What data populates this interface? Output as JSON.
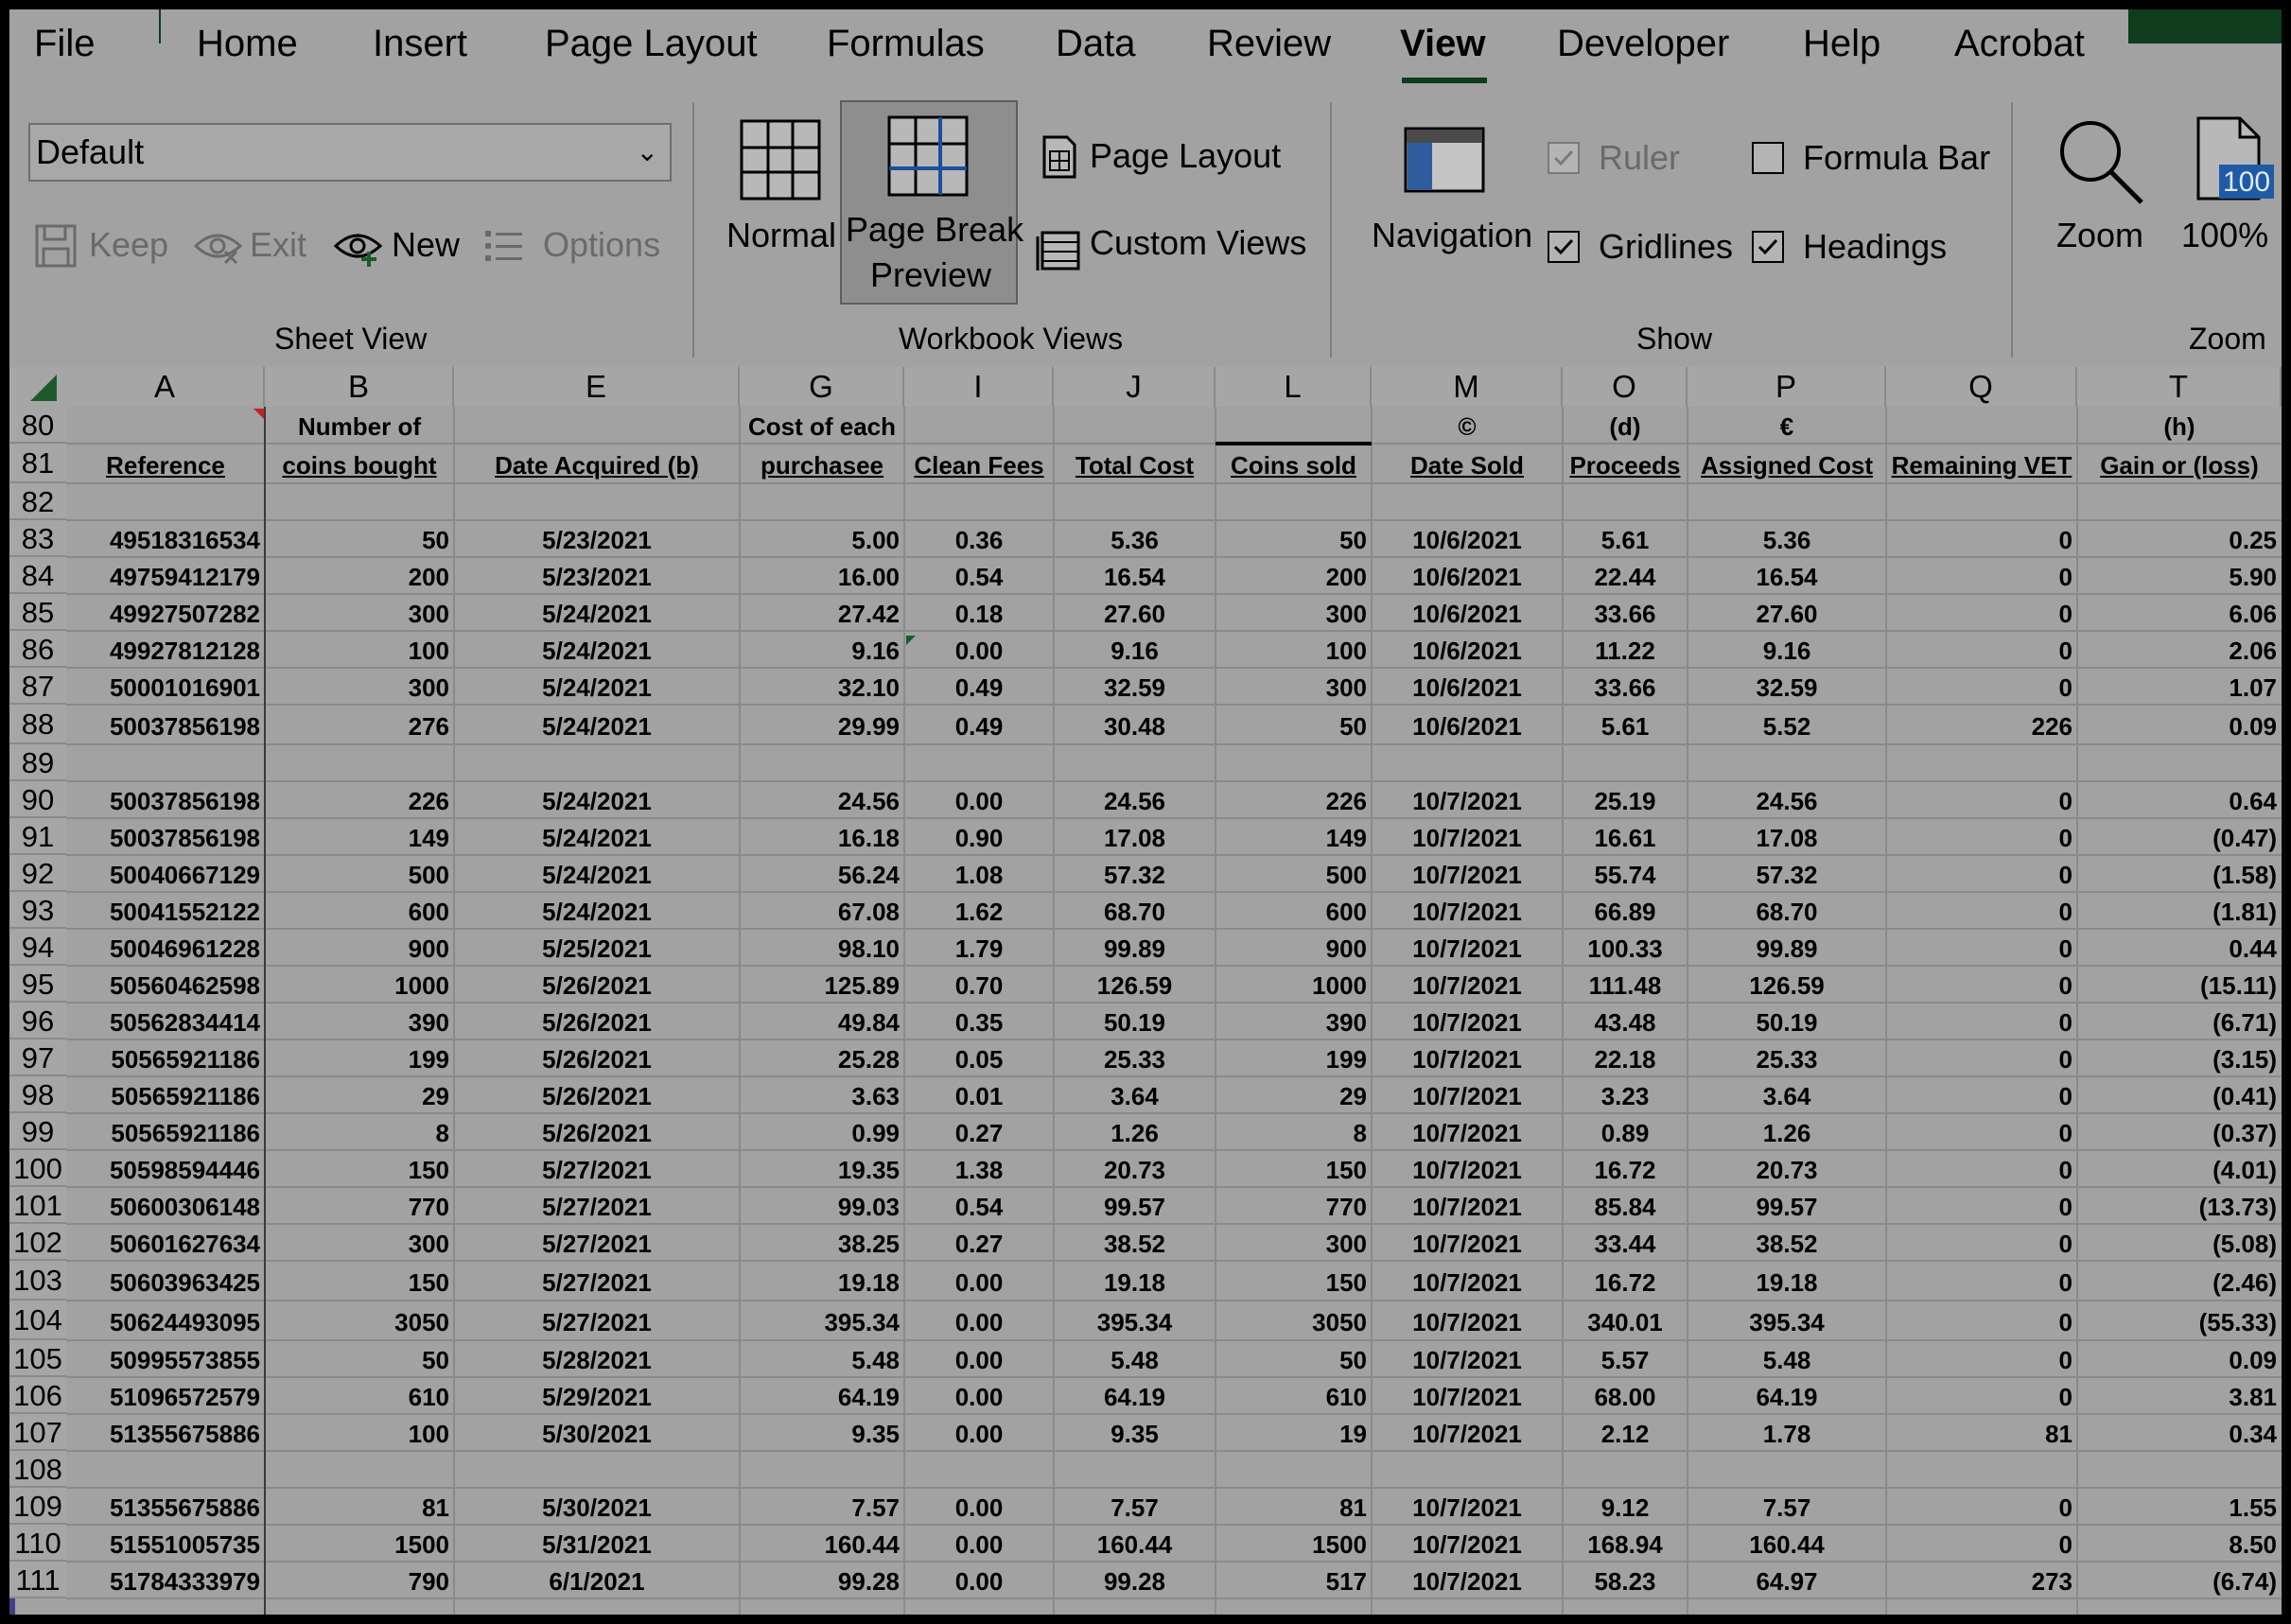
{
  "menu": {
    "tabs": [
      "File",
      "Home",
      "Insert",
      "Page Layout",
      "Formulas",
      "Data",
      "Review",
      "View",
      "Developer",
      "Help",
      "Acrobat"
    ],
    "active": "View"
  },
  "ribbon": {
    "sheet_view": {
      "select_value": "Default",
      "keep": "Keep",
      "exit": "Exit",
      "new": "New",
      "options": "Options",
      "label": "Sheet View"
    },
    "workbook_views": {
      "normal": "Normal",
      "page_break_1": "Page Break",
      "page_break_2": "Preview",
      "page_layout": "Page Layout",
      "custom_views": "Custom Views",
      "label": "Workbook Views"
    },
    "show": {
      "navigation": "Navigation",
      "ruler": "Ruler",
      "formula_bar": "Formula Bar",
      "gridlines": "Gridlines",
      "headings": "Headings",
      "label": "Show"
    },
    "zoom": {
      "zoom": "Zoom",
      "hundred": "100%",
      "icon_text": "100",
      "label": "Zoom"
    }
  },
  "sheet": {
    "columns": [
      "A",
      "B",
      "E",
      "G",
      "I",
      "J",
      "L",
      "M",
      "O",
      "P",
      "Q",
      "T"
    ],
    "header_rows": [
      {
        "row": "80",
        "cells": [
          "",
          "Number of",
          "",
          "Cost of each",
          "",
          "",
          "",
          "©",
          "(d)",
          "€",
          "",
          "(h)"
        ]
      },
      {
        "row": "81",
        "cells": [
          "Reference",
          "coins bought",
          "Date Acquired (b)",
          "purchasee",
          "Clean Fees",
          "Total Cost",
          "Coins sold",
          "Date Sold",
          "Proceeds",
          "Assigned Cost",
          "Remaining VET",
          "Gain or (loss)"
        ]
      }
    ],
    "rows": [
      {
        "row": "82",
        "cells": [
          "",
          "",
          "",
          "",
          "",
          "",
          "",
          "",
          "",
          "",
          "",
          ""
        ]
      },
      {
        "row": "83",
        "cells": [
          "49518316534",
          "50",
          "5/23/2021",
          "5.00",
          "0.36",
          "5.36",
          "50",
          "10/6/2021",
          "5.61",
          "5.36",
          "0",
          "0.25"
        ]
      },
      {
        "row": "84",
        "cells": [
          "49759412179",
          "200",
          "5/23/2021",
          "16.00",
          "0.54",
          "16.54",
          "200",
          "10/6/2021",
          "22.44",
          "16.54",
          "0",
          "5.90"
        ]
      },
      {
        "row": "85",
        "cells": [
          "49927507282",
          "300",
          "5/24/2021",
          "27.42",
          "0.18",
          "27.60",
          "300",
          "10/6/2021",
          "33.66",
          "27.60",
          "0",
          "6.06"
        ]
      },
      {
        "row": "86",
        "cells": [
          "49927812128",
          "100",
          "5/24/2021",
          "9.16",
          "0.00",
          "9.16",
          "100",
          "10/6/2021",
          "11.22",
          "9.16",
          "0",
          "2.06"
        ]
      },
      {
        "row": "87",
        "cells": [
          "50001016901",
          "300",
          "5/24/2021",
          "32.10",
          "0.49",
          "32.59",
          "300",
          "10/6/2021",
          "33.66",
          "32.59",
          "0",
          "1.07"
        ]
      },
      {
        "row": "88",
        "cells": [
          "50037856198",
          "276",
          "5/24/2021",
          "29.99",
          "0.49",
          "30.48",
          "50",
          "10/6/2021",
          "5.61",
          "5.52",
          "226",
          "0.09"
        ]
      },
      {
        "row": "89",
        "cells": [
          "",
          "",
          "",
          "",
          "",
          "",
          "",
          "",
          "",
          "",
          "",
          ""
        ]
      },
      {
        "row": "90",
        "cells": [
          "50037856198",
          "226",
          "5/24/2021",
          "24.56",
          "0.00",
          "24.56",
          "226",
          "10/7/2021",
          "25.19",
          "24.56",
          "0",
          "0.64"
        ]
      },
      {
        "row": "91",
        "cells": [
          "50037856198",
          "149",
          "5/24/2021",
          "16.18",
          "0.90",
          "17.08",
          "149",
          "10/7/2021",
          "16.61",
          "17.08",
          "0",
          "(0.47)"
        ]
      },
      {
        "row": "92",
        "cells": [
          "50040667129",
          "500",
          "5/24/2021",
          "56.24",
          "1.08",
          "57.32",
          "500",
          "10/7/2021",
          "55.74",
          "57.32",
          "0",
          "(1.58)"
        ]
      },
      {
        "row": "93",
        "cells": [
          "50041552122",
          "600",
          "5/24/2021",
          "67.08",
          "1.62",
          "68.70",
          "600",
          "10/7/2021",
          "66.89",
          "68.70",
          "0",
          "(1.81)"
        ]
      },
      {
        "row": "94",
        "cells": [
          "50046961228",
          "900",
          "5/25/2021",
          "98.10",
          "1.79",
          "99.89",
          "900",
          "10/7/2021",
          "100.33",
          "99.89",
          "0",
          "0.44"
        ]
      },
      {
        "row": "95",
        "cells": [
          "50560462598",
          "1000",
          "5/26/2021",
          "125.89",
          "0.70",
          "126.59",
          "1000",
          "10/7/2021",
          "111.48",
          "126.59",
          "0",
          "(15.11)"
        ]
      },
      {
        "row": "96",
        "cells": [
          "50562834414",
          "390",
          "5/26/2021",
          "49.84",
          "0.35",
          "50.19",
          "390",
          "10/7/2021",
          "43.48",
          "50.19",
          "0",
          "(6.71)"
        ]
      },
      {
        "row": "97",
        "cells": [
          "50565921186",
          "199",
          "5/26/2021",
          "25.28",
          "0.05",
          "25.33",
          "199",
          "10/7/2021",
          "22.18",
          "25.33",
          "0",
          "(3.15)"
        ]
      },
      {
        "row": "98",
        "cells": [
          "50565921186",
          "29",
          "5/26/2021",
          "3.63",
          "0.01",
          "3.64",
          "29",
          "10/7/2021",
          "3.23",
          "3.64",
          "0",
          "(0.41)"
        ]
      },
      {
        "row": "99",
        "cells": [
          "50565921186",
          "8",
          "5/26/2021",
          "0.99",
          "0.27",
          "1.26",
          "8",
          "10/7/2021",
          "0.89",
          "1.26",
          "0",
          "(0.37)"
        ]
      },
      {
        "row": "100",
        "cells": [
          "50598594446",
          "150",
          "5/27/2021",
          "19.35",
          "1.38",
          "20.73",
          "150",
          "10/7/2021",
          "16.72",
          "20.73",
          "0",
          "(4.01)"
        ]
      },
      {
        "row": "101",
        "cells": [
          "50600306148",
          "770",
          "5/27/2021",
          "99.03",
          "0.54",
          "99.57",
          "770",
          "10/7/2021",
          "85.84",
          "99.57",
          "0",
          "(13.73)"
        ]
      },
      {
        "row": "102",
        "cells": [
          "50601627634",
          "300",
          "5/27/2021",
          "38.25",
          "0.27",
          "38.52",
          "300",
          "10/7/2021",
          "33.44",
          "38.52",
          "0",
          "(5.08)"
        ]
      },
      {
        "row": "103",
        "cells": [
          "50603963425",
          "150",
          "5/27/2021",
          "19.18",
          "0.00",
          "19.18",
          "150",
          "10/7/2021",
          "16.72",
          "19.18",
          "0",
          "(2.46)"
        ]
      },
      {
        "row": "104",
        "cells": [
          "50624493095",
          "3050",
          "5/27/2021",
          "395.34",
          "0.00",
          "395.34",
          "3050",
          "10/7/2021",
          "340.01",
          "395.34",
          "0",
          "(55.33)"
        ]
      },
      {
        "row": "105",
        "cells": [
          "50995573855",
          "50",
          "5/28/2021",
          "5.48",
          "0.00",
          "5.48",
          "50",
          "10/7/2021",
          "5.57",
          "5.48",
          "0",
          "0.09"
        ]
      },
      {
        "row": "106",
        "cells": [
          "51096572579",
          "610",
          "5/29/2021",
          "64.19",
          "0.00",
          "64.19",
          "610",
          "10/7/2021",
          "68.00",
          "64.19",
          "0",
          "3.81"
        ]
      },
      {
        "row": "107",
        "cells": [
          "51355675886",
          "100",
          "5/30/2021",
          "9.35",
          "0.00",
          "9.35",
          "19",
          "10/7/2021",
          "2.12",
          "1.78",
          "81",
          "0.34"
        ]
      },
      {
        "row": "108",
        "cells": [
          "",
          "",
          "",
          "",
          "",
          "",
          "",
          "",
          "",
          "",
          "",
          ""
        ]
      },
      {
        "row": "109",
        "cells": [
          "51355675886",
          "81",
          "5/30/2021",
          "7.57",
          "0.00",
          "7.57",
          "81",
          "10/7/2021",
          "9.12",
          "7.57",
          "0",
          "1.55"
        ]
      },
      {
        "row": "110",
        "cells": [
          "51551005735",
          "1500",
          "5/31/2021",
          "160.44",
          "0.00",
          "160.44",
          "1500",
          "10/7/2021",
          "168.94",
          "160.44",
          "0",
          "8.50"
        ]
      },
      {
        "row": "111",
        "cells": [
          "51784333979",
          "790",
          "6/1/2021",
          "99.28",
          "0.00",
          "99.28",
          "517",
          "10/7/2021",
          "58.23",
          "64.97",
          "273",
          "(6.74)"
        ]
      }
    ]
  }
}
